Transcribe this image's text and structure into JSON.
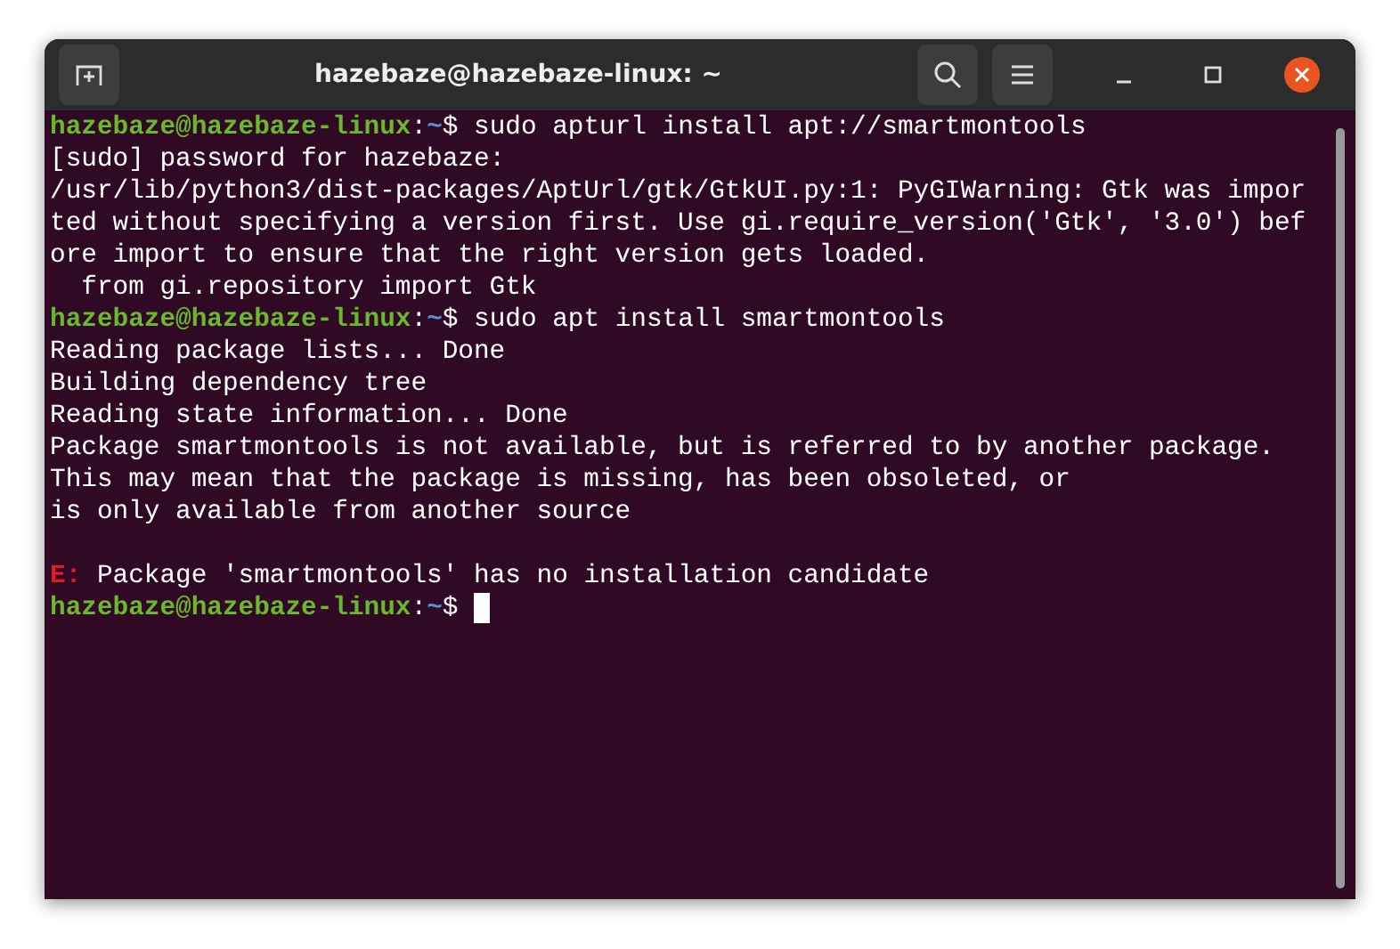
{
  "window": {
    "title": "hazebaze@hazebaze-linux: ~"
  },
  "terminal": {
    "lines": [
      {
        "kind": "prompt",
        "user": "hazebaze@hazebaze-linux",
        "separator": ":",
        "path": "~",
        "symbol": "$",
        "command": "sudo apturl install apt://smartmontools"
      },
      {
        "kind": "output",
        "text": "[sudo] password for hazebaze:"
      },
      {
        "kind": "output",
        "text": "/usr/lib/python3/dist-packages/AptUrl/gtk/GtkUI.py:1: PyGIWarning: Gtk was impor"
      },
      {
        "kind": "output",
        "text": "ted without specifying a version first. Use gi.require_version('Gtk', '3.0') bef"
      },
      {
        "kind": "output",
        "text": "ore import to ensure that the right version gets loaded."
      },
      {
        "kind": "output",
        "text": "  from gi.repository import Gtk"
      },
      {
        "kind": "prompt",
        "user": "hazebaze@hazebaze-linux",
        "separator": ":",
        "path": "~",
        "symbol": "$",
        "command": "sudo apt install smartmontools"
      },
      {
        "kind": "output",
        "text": "Reading package lists... Done"
      },
      {
        "kind": "output",
        "text": "Building dependency tree"
      },
      {
        "kind": "output",
        "text": "Reading state information... Done"
      },
      {
        "kind": "output",
        "text": "Package smartmontools is not available, but is referred to by another package."
      },
      {
        "kind": "output",
        "text": "This may mean that the package is missing, has been obsoleted, or"
      },
      {
        "kind": "output",
        "text": "is only available from another source"
      },
      {
        "kind": "blank"
      },
      {
        "kind": "error",
        "label": "E:",
        "text": "Package 'smartmontools' has no installation candidate"
      },
      {
        "kind": "prompt",
        "user": "hazebaze@hazebaze-linux",
        "separator": ":",
        "path": "~",
        "symbol": "$",
        "cursor": true
      }
    ]
  }
}
